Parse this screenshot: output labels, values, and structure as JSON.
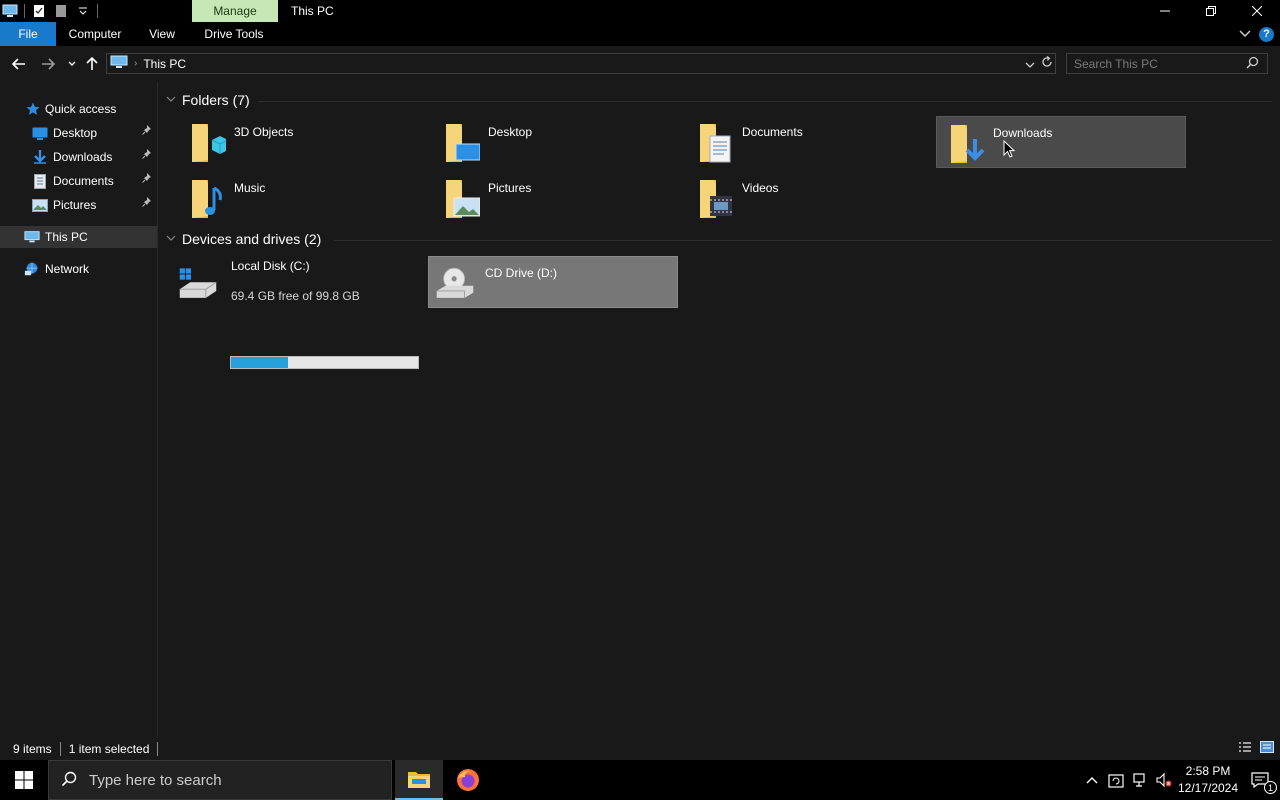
{
  "window": {
    "title": "This PC",
    "context_tab": "Manage"
  },
  "ribbon": {
    "tabs": [
      "File",
      "Computer",
      "View",
      "Drive Tools"
    ]
  },
  "address": {
    "crumb": "This PC",
    "search_placeholder": "Search This PC"
  },
  "sidebar": {
    "quick_access": "Quick access",
    "items": [
      {
        "label": "Desktop",
        "pinned": true
      },
      {
        "label": "Downloads",
        "pinned": true
      },
      {
        "label": "Documents",
        "pinned": true
      },
      {
        "label": "Pictures",
        "pinned": true
      }
    ],
    "this_pc": "This PC",
    "network": "Network"
  },
  "folders": {
    "header": "Folders (7)",
    "items": [
      "3D Objects",
      "Desktop",
      "Documents",
      "Downloads",
      "Music",
      "Pictures",
      "Videos"
    ]
  },
  "drives": {
    "header": "Devices and drives (2)",
    "local": {
      "name": "Local Disk (C:)",
      "info": "69.4 GB free of 99.8 GB",
      "used_fraction": 0.305
    },
    "cd": {
      "name": "CD Drive (D:)"
    }
  },
  "status": {
    "count": "9 items",
    "selected": "1 item selected"
  },
  "taskbar": {
    "search_placeholder": "Type here to search",
    "time": "2:58 PM",
    "date": "12/17/2024",
    "notification_count": "1"
  },
  "colors": {
    "accent": "#1979ca",
    "manage_tab": "#c6e7b6",
    "drive_fill": "#26a0da",
    "folder": "#f0c75e"
  }
}
